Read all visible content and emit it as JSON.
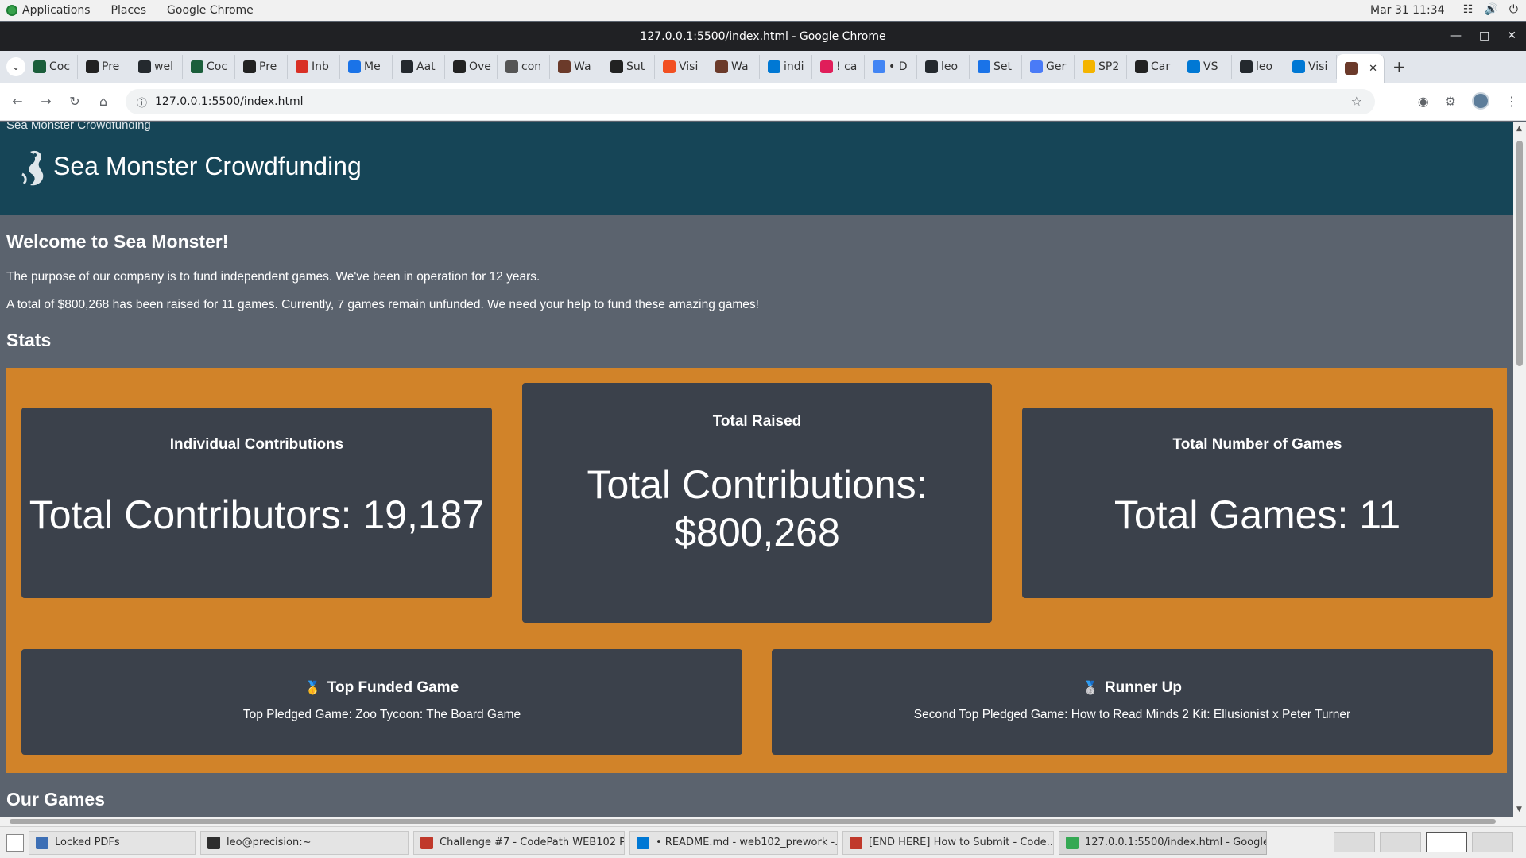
{
  "topbar": {
    "applications": "Applications",
    "places": "Places",
    "app_name": "Google Chrome",
    "clock": "Mar 31  11:34"
  },
  "window": {
    "title": "127.0.0.1:5500/index.html - Google Chrome"
  },
  "tabs": [
    {
      "label": "Coc",
      "icon": "codepath-icon",
      "color": "#1b5e3b"
    },
    {
      "label": "Pre",
      "icon": "codepath-icon",
      "color": "#222222"
    },
    {
      "label": "wel",
      "icon": "github-icon",
      "color": "#24292e"
    },
    {
      "label": "Coc",
      "icon": "codepath-icon",
      "color": "#1b5e3b"
    },
    {
      "label": "Pre",
      "icon": "codepath-icon",
      "color": "#222222"
    },
    {
      "label": "Inb",
      "icon": "gmail-icon",
      "color": "#d93025"
    },
    {
      "label": "Me",
      "icon": "slides-icon",
      "color": "#1a73e8"
    },
    {
      "label": "Aat",
      "icon": "github-icon",
      "color": "#24292e"
    },
    {
      "label": "Ove",
      "icon": "codepath-icon",
      "color": "#222222"
    },
    {
      "label": "con",
      "icon": "globe-icon",
      "color": "#555555"
    },
    {
      "label": "Wa",
      "icon": "web-icon",
      "color": "#6b3a2a"
    },
    {
      "label": "Sut",
      "icon": "codepath-icon",
      "color": "#222222"
    },
    {
      "label": "Visi",
      "icon": "microsoft-icon",
      "color": "#f25022"
    },
    {
      "label": "Wa",
      "icon": "web-icon",
      "color": "#6b3a2a"
    },
    {
      "label": "indi",
      "icon": "vscode-icon",
      "color": "#0078d4"
    },
    {
      "label": "! ca",
      "icon": "slack-icon",
      "color": "#e01e5a"
    },
    {
      "label": "• D",
      "icon": "google-icon",
      "color": "#4285f4"
    },
    {
      "label": "leo",
      "icon": "github-icon",
      "color": "#24292e"
    },
    {
      "label": "Set",
      "icon": "gear-icon",
      "color": "#1a73e8"
    },
    {
      "label": "Ger",
      "icon": "gemini-icon",
      "color": "#4a7bf7"
    },
    {
      "label": "SP2",
      "icon": "slides-icon",
      "color": "#f4b400"
    },
    {
      "label": "Car",
      "icon": "codepath-icon",
      "color": "#222222"
    },
    {
      "label": "VS",
      "icon": "vscode-icon",
      "color": "#0078d4"
    },
    {
      "label": "leo",
      "icon": "github-icon",
      "color": "#24292e"
    },
    {
      "label": "Visi",
      "icon": "vscode-icon",
      "color": "#0078d4"
    }
  ],
  "active_tab": {
    "icon": "web-icon",
    "color": "#6b3a2a"
  },
  "omnibox": {
    "url": "127.0.0.1:5500/index.html"
  },
  "page": {
    "tiny_title": "Sea Monster Crowdfunding",
    "title": "Sea Monster Crowdfunding",
    "welcome": "Welcome to Sea Monster!",
    "description": "The purpose of our company is to fund independent games. We've been in operation for 12 years.",
    "summary": "A total of $800,268 has been raised for 11 games. Currently, 7 games remain unfunded. We need your help to fund these amazing games!",
    "stats_heading": "Stats",
    "cards": {
      "contributions": {
        "title": "Individual Contributions",
        "value": "Total Contributors: 19,187"
      },
      "raised": {
        "title": "Total Raised",
        "value": "Total Contributions: $800,268"
      },
      "games": {
        "title": "Total Number of Games",
        "value": "Total Games: 11"
      },
      "top": {
        "title": "Top Funded Game",
        "value": "Top Pledged Game: Zoo Tycoon: The Board Game"
      },
      "runner": {
        "title": "Runner Up",
        "value": "Second Top Pledged Game: How to Read Minds 2 Kit: Ellusionist x Peter Turner"
      }
    },
    "games_heading": "Our Games"
  },
  "taskbar": [
    {
      "label": "Locked PDFs",
      "icon": "files-icon",
      "color": "#3d6fb5"
    },
    {
      "label": "leo@precision:~",
      "icon": "terminal-icon",
      "color": "#2e2e2e"
    },
    {
      "label": "Challenge #7 - CodePath WEB102 P...",
      "icon": "chrome-doc-icon",
      "color": "#c0392b"
    },
    {
      "label": "• README.md - web102_prework -...",
      "icon": "vscode-icon",
      "color": "#0078d4"
    },
    {
      "label": "[END HERE] How to Submit - Code...",
      "icon": "chrome-doc-icon",
      "color": "#c0392b"
    },
    {
      "label": "127.0.0.1:5500/index.html - Google...",
      "icon": "chrome-icon",
      "color": "#34a853"
    }
  ],
  "colors": {
    "header_bg": "#164557",
    "page_bg": "#5b636e",
    "stats_bg": "#d18329",
    "card_bg": "#3b414b"
  }
}
